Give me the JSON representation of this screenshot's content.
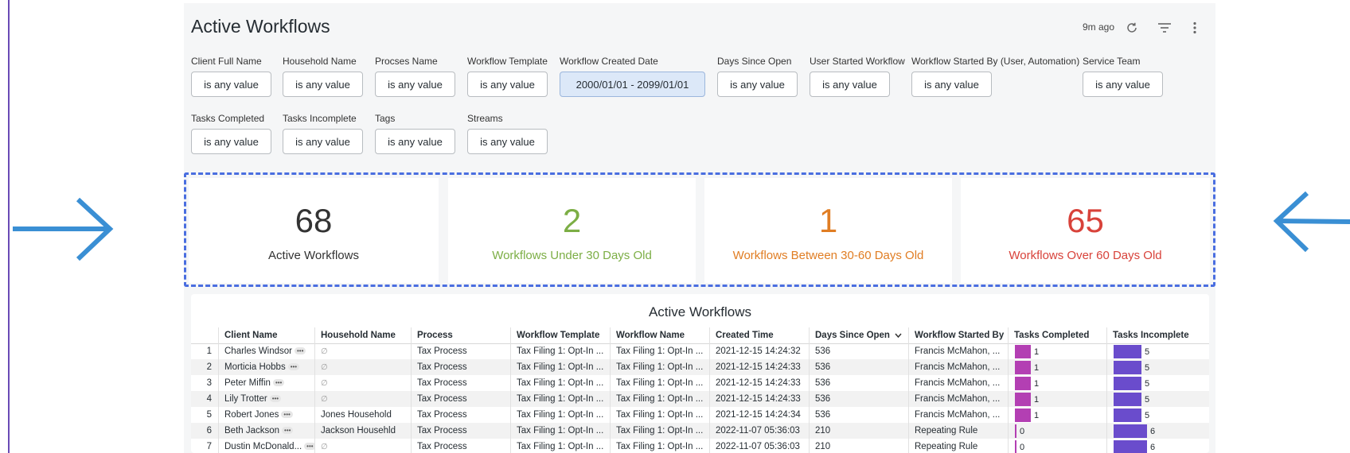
{
  "colors": {
    "accent_blue": "#3a8fd4",
    "frame": "#4a6ee0",
    "kpi_total": "#333333",
    "kpi_under30": "#7cae45",
    "kpi_30to60": "#e07d23",
    "kpi_over60": "#d8423a",
    "bar_completed": "#b33fb3",
    "bar_incomplete": "#6a4ccc"
  },
  "header": {
    "title": "Active Workflows",
    "updated": "9m ago",
    "icons": [
      "refresh-icon",
      "filter-icon",
      "more-vert-icon"
    ]
  },
  "filters": [
    {
      "label": "Client Full Name",
      "value": "is any value"
    },
    {
      "label": "Household Name",
      "value": "is any value"
    },
    {
      "label": "Procses Name",
      "value": "is any value"
    },
    {
      "label": "Workflow Template",
      "value": "is any value"
    },
    {
      "label": "Workflow Created Date",
      "value": "2000/01/01 - 2099/01/01"
    },
    {
      "label": "Days Since Open",
      "value": "is any value"
    },
    {
      "label": "User Started Workflow",
      "value": "is any value"
    },
    {
      "label": "Workflow Started By (User, Automation)",
      "value": "is any value"
    },
    {
      "label": "Service Team",
      "value": "is any value"
    },
    {
      "label": "Tasks Completed",
      "value": "is any value"
    },
    {
      "label": "Tasks Incomplete",
      "value": "is any value"
    },
    {
      "label": "Tags",
      "value": "is any value"
    },
    {
      "label": "Streams",
      "value": "is any value"
    }
  ],
  "kpis": [
    {
      "value": "68",
      "caption": "Active Workflows"
    },
    {
      "value": "2",
      "caption": "Workflows Under 30 Days Old"
    },
    {
      "value": "1",
      "caption": "Workflows Between 30-60 Days Old"
    },
    {
      "value": "65",
      "caption": "Workflows Over 60 Days Old"
    }
  ],
  "table": {
    "title": "Active Workflows",
    "columns": [
      "Client Name",
      "Household Name",
      "Process",
      "Workflow Template",
      "Workflow Name",
      "Created Time",
      "Days Since Open",
      "Workflow Started By",
      "Tasks Completed",
      "Tasks Incomplete"
    ],
    "sorted_column": "Days Since Open",
    "rows": [
      {
        "n": "1",
        "client": "Charles Windsor",
        "household": "",
        "process": "Tax Process",
        "template": "Tax Filing 1: Opt-In ...",
        "name": "Tax Filing 1: Opt-In ...",
        "created": "2021-12-15 14:24:32",
        "days": "536",
        "started_by": "Francis McMahon, ...",
        "completed": 1,
        "incomplete": 5
      },
      {
        "n": "2",
        "client": "Morticia Hobbs",
        "household": "",
        "process": "Tax Process",
        "template": "Tax Filing 1: Opt-In ...",
        "name": "Tax Filing 1: Opt-In ...",
        "created": "2021-12-15 14:24:33",
        "days": "536",
        "started_by": "Francis McMahon, ...",
        "completed": 1,
        "incomplete": 5
      },
      {
        "n": "3",
        "client": "Peter Miffin",
        "household": "",
        "process": "Tax Process",
        "template": "Tax Filing 1: Opt-In ...",
        "name": "Tax Filing 1: Opt-In ...",
        "created": "2021-12-15 14:24:33",
        "days": "536",
        "started_by": "Francis McMahon, ...",
        "completed": 1,
        "incomplete": 5
      },
      {
        "n": "4",
        "client": "Lily Trotter",
        "household": "",
        "process": "Tax Process",
        "template": "Tax Filing 1: Opt-In ...",
        "name": "Tax Filing 1: Opt-In ...",
        "created": "2021-12-15 14:24:33",
        "days": "536",
        "started_by": "Francis McMahon, ...",
        "completed": 1,
        "incomplete": 5
      },
      {
        "n": "5",
        "client": "Robert Jones",
        "household": "Jones Household",
        "process": "Tax Process",
        "template": "Tax Filing 1: Opt-In ...",
        "name": "Tax Filing 1: Opt-In ...",
        "created": "2021-12-15 14:24:34",
        "days": "536",
        "started_by": "Francis McMahon, ...",
        "completed": 1,
        "incomplete": 5
      },
      {
        "n": "6",
        "client": "Beth Jackson",
        "household": "Jackson Househld",
        "process": "Tax Process",
        "template": "Tax Filing 1: Opt-In ...",
        "name": "Tax Filing 1: Opt-In ...",
        "created": "2022-11-07 05:36:03",
        "days": "210",
        "started_by": "Repeating Rule",
        "completed": 0,
        "incomplete": 6
      },
      {
        "n": "7",
        "client": "Dustin McDonald...",
        "household": "",
        "process": "Tax Process",
        "template": "Tax Filing 1: Opt-In ...",
        "name": "Tax Filing 1: Opt-In ...",
        "created": "2022-11-07 05:36:03",
        "days": "210",
        "started_by": "Repeating Rule",
        "completed": 0,
        "incomplete": 6
      }
    ]
  }
}
